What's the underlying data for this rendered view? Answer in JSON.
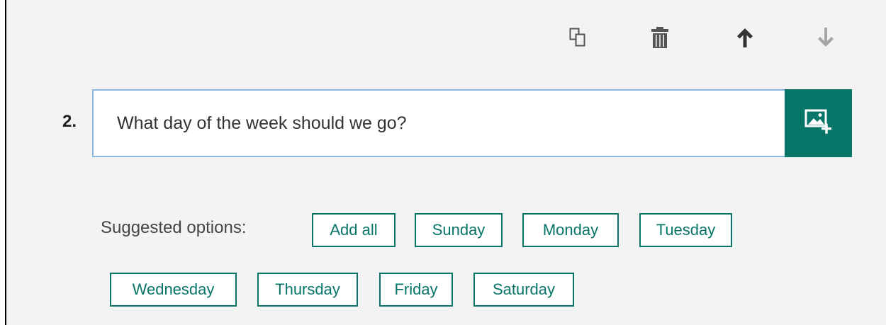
{
  "toolbar": {
    "copy_icon": "copy-icon",
    "delete_icon": "trash-icon",
    "move_up_icon": "arrow-up-icon",
    "move_down_icon": "arrow-down-icon"
  },
  "question": {
    "number": "2.",
    "title": "What day of the week should we go?",
    "insert_media_icon": "image-add-icon"
  },
  "suggestions": {
    "label": "Suggested options:",
    "add_all": "Add all",
    "options": [
      "Sunday",
      "Monday",
      "Tuesday",
      "Wednesday",
      "Thursday",
      "Friday",
      "Saturday"
    ]
  },
  "colors": {
    "accent": "#077568",
    "panel_bg": "#f3f3f3",
    "input_border": "#8ab6df",
    "icon_dark": "#444444",
    "icon_disabled": "#a6a6a6"
  }
}
